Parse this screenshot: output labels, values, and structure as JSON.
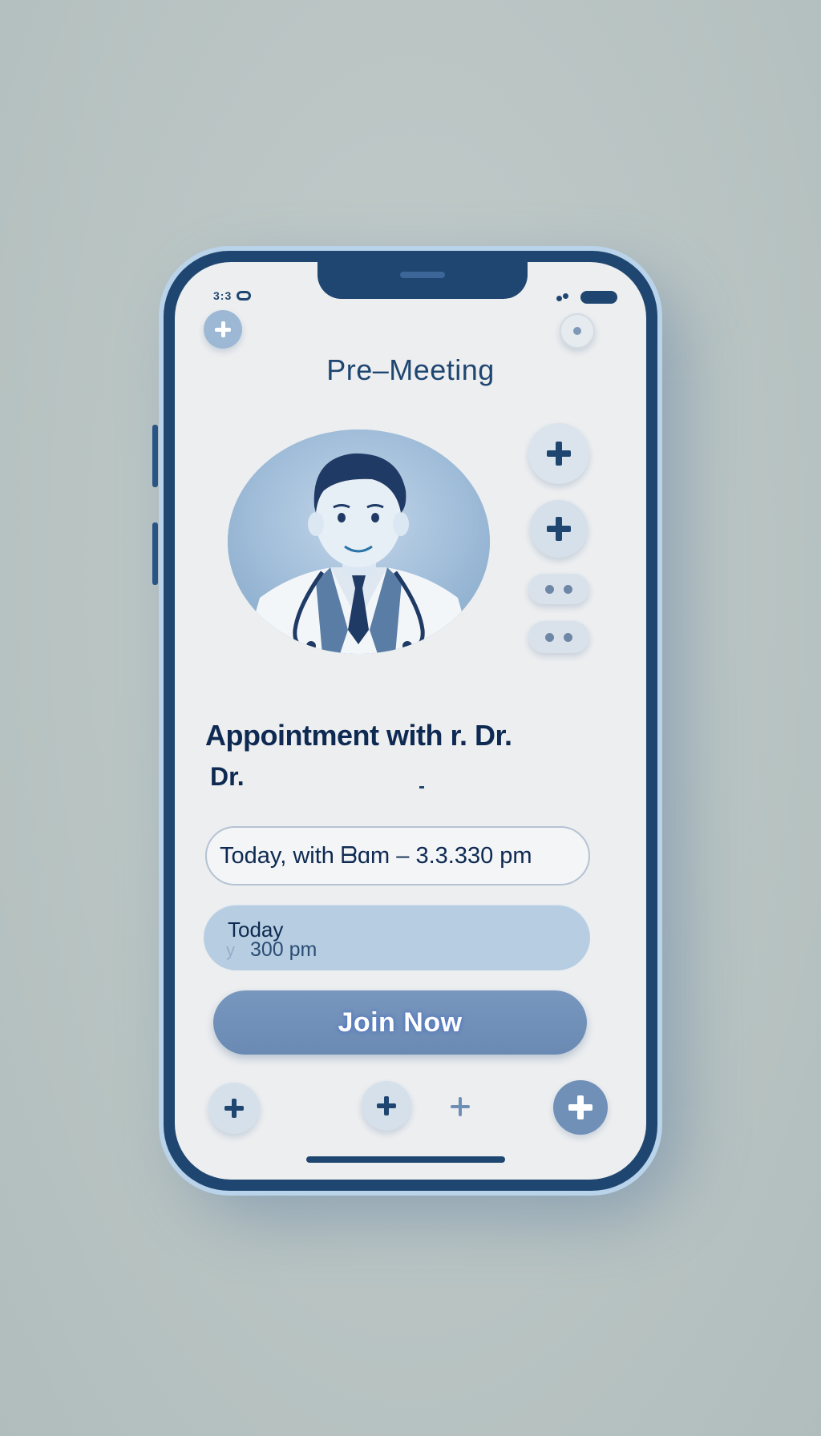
{
  "status_bar": {
    "time": "3:3",
    "time_extra": ""
  },
  "header": {
    "title": "Pre–Meeting"
  },
  "appointment": {
    "title": "Appointment with  r. Dr.",
    "doctor": "Dr.",
    "time_range": "Today, with ᗷɑm – 3.3.330 pm",
    "today_label": "Today",
    "today_time": "300 pm",
    "today_ghost": "y"
  },
  "actions": {
    "join_label": "Join Now"
  },
  "colors": {
    "navy": "#1f4670",
    "screen": "#eceef0",
    "accent_button": "#7897bf",
    "card": "#b7cde1"
  },
  "icons": {
    "top_left": "plus-icon",
    "top_right": "dot-icon",
    "side": [
      "plus-icon",
      "plus-icon",
      "dots-icon",
      "dots-icon"
    ],
    "bottom": [
      "plus-icon",
      "plus-icon",
      "plus-icon",
      "plus-icon"
    ]
  }
}
